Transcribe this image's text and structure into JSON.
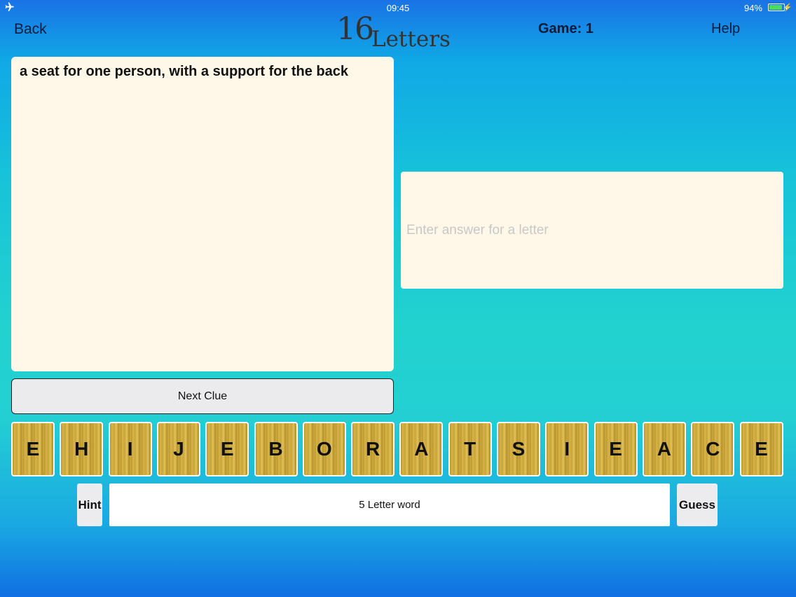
{
  "status_bar": {
    "time": "09:45",
    "battery": "94%",
    "icons": [
      "airplane-icon",
      "battery-icon",
      "charging-bolt-icon"
    ]
  },
  "header": {
    "back_label": "Back",
    "logo_number": "16",
    "logo_word": "Letters",
    "game_label": "Game: 1",
    "help_label": "Help"
  },
  "clue": {
    "text": "a seat for one person, with a support for the back"
  },
  "answer": {
    "placeholder": "Enter answer for a letter"
  },
  "next_clue_label": "Next Clue",
  "tiles": [
    "E",
    "H",
    "I",
    "J",
    "E",
    "B",
    "O",
    "R",
    "A",
    "T",
    "S",
    "I",
    "E",
    "A",
    "C",
    "E"
  ],
  "hint_label": "Hint",
  "word_length_label": "5 Letter word",
  "guess_label": "Guess",
  "colors": {
    "panel": "#fff8e8",
    "tile_wood": "#d7b348",
    "text_dark": "#0d1b3a"
  }
}
